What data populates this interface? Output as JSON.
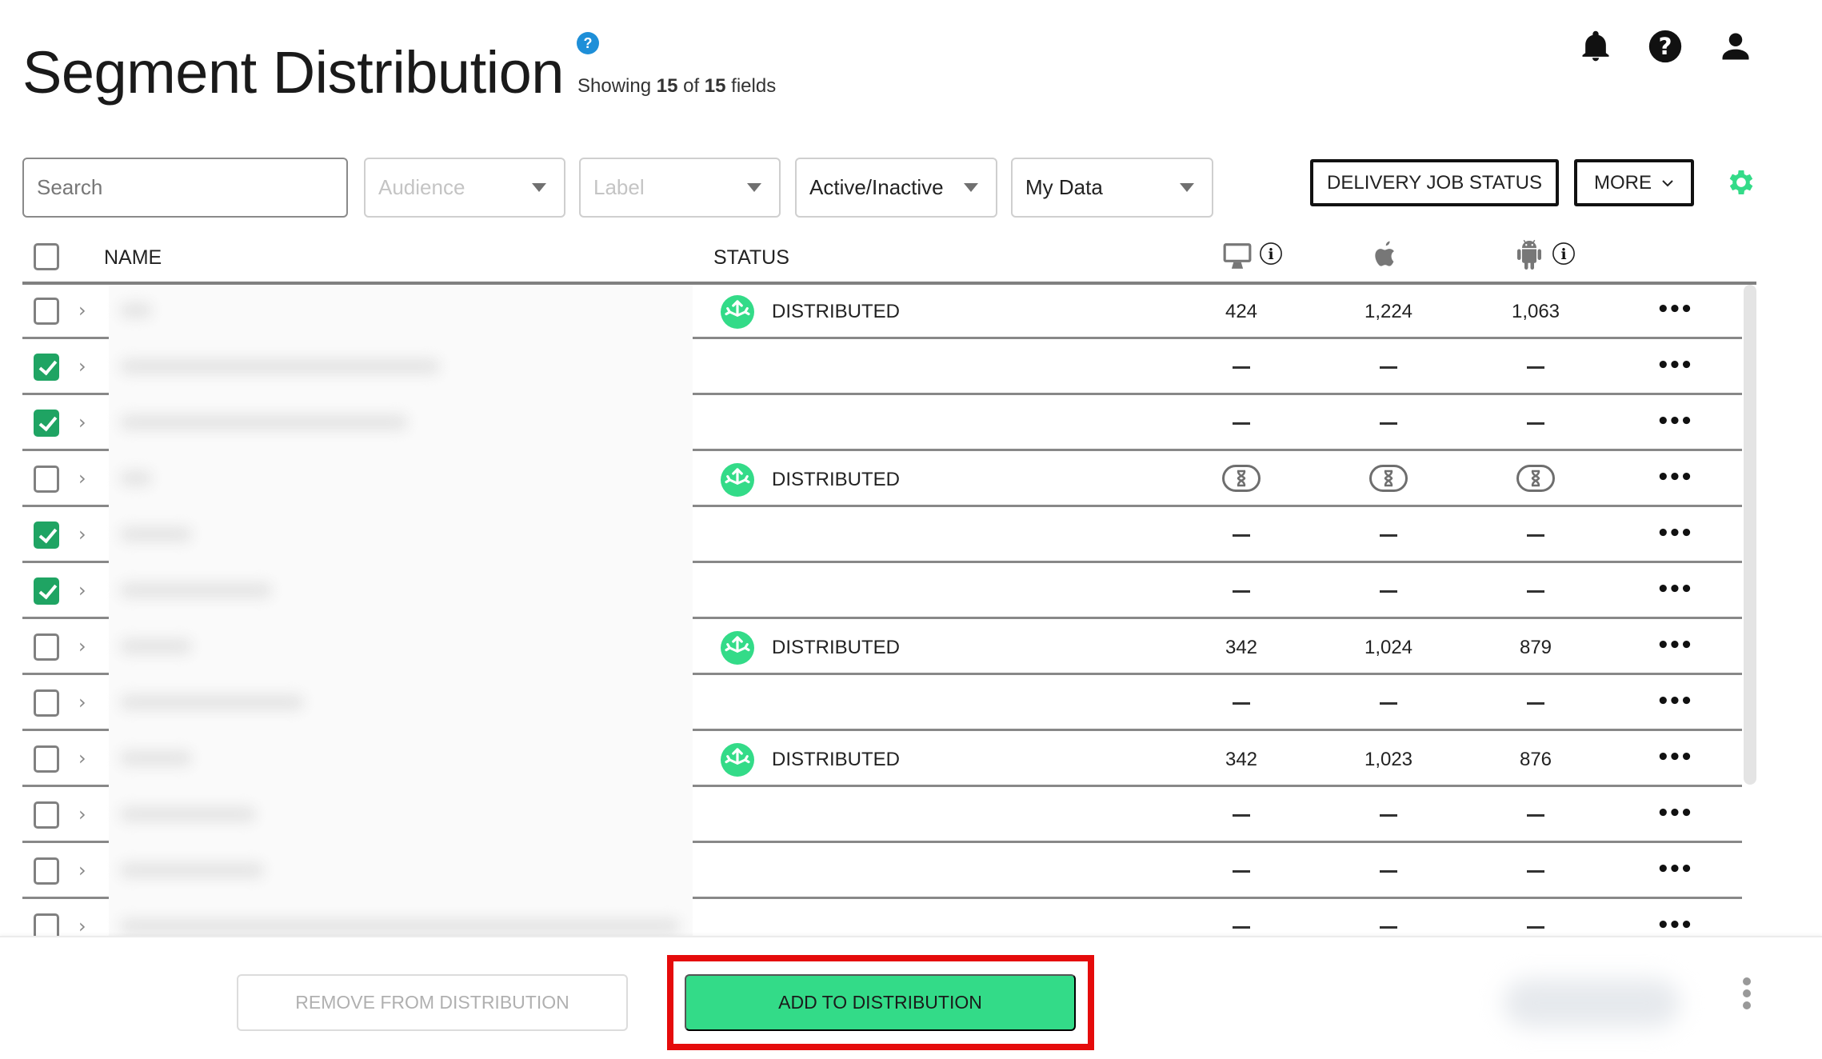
{
  "header": {
    "title": "Segment Distribution",
    "help_icon": "question-circle-icon",
    "subtitle": {
      "prefix": "Showing ",
      "shown": "15",
      "middle": " of ",
      "total": "15",
      "suffix": " fields"
    },
    "icons": [
      "bell-icon",
      "help-circle-icon",
      "user-icon"
    ]
  },
  "filters": {
    "search_placeholder": "Search",
    "audience_placeholder": "Audience",
    "label_placeholder": "Label",
    "active_inactive_value": "Active/Inactive",
    "my_data_value": "My Data"
  },
  "toolbar": {
    "delivery_job_status": "DELIVERY JOB STATUS",
    "more": "MORE",
    "settings_icon": "gear-icon",
    "accent_color": "#33db88"
  },
  "table": {
    "columns": {
      "name": "NAME",
      "status": "STATUS",
      "desktop": "desktop-icon",
      "ios": "apple-icon",
      "android": "android-icon"
    },
    "rows": [
      {
        "checked": false,
        "status": "DISTRIBUTED",
        "desktop": "424",
        "ios": "1,224",
        "android": "1,063",
        "kind": "values"
      },
      {
        "checked": true,
        "status": "",
        "kind": "dash"
      },
      {
        "checked": true,
        "status": "",
        "kind": "dash"
      },
      {
        "checked": false,
        "status": "DISTRIBUTED",
        "kind": "pending"
      },
      {
        "checked": true,
        "status": "",
        "kind": "dash"
      },
      {
        "checked": true,
        "status": "",
        "kind": "dash"
      },
      {
        "checked": false,
        "status": "DISTRIBUTED",
        "desktop": "342",
        "ios": "1,024",
        "android": "879",
        "kind": "values"
      },
      {
        "checked": false,
        "status": "",
        "kind": "dash"
      },
      {
        "checked": false,
        "status": "DISTRIBUTED",
        "desktop": "342",
        "ios": "1,023",
        "android": "876",
        "kind": "values"
      },
      {
        "checked": false,
        "status": "",
        "kind": "dash"
      },
      {
        "checked": false,
        "status": "",
        "kind": "dash"
      },
      {
        "checked": false,
        "status": "",
        "kind": "dash"
      }
    ]
  },
  "footer": {
    "remove_label": "REMOVE FROM DISTRIBUTION",
    "add_label": "ADD TO DISTRIBUTION",
    "highlight_color": "#e50b0b"
  }
}
